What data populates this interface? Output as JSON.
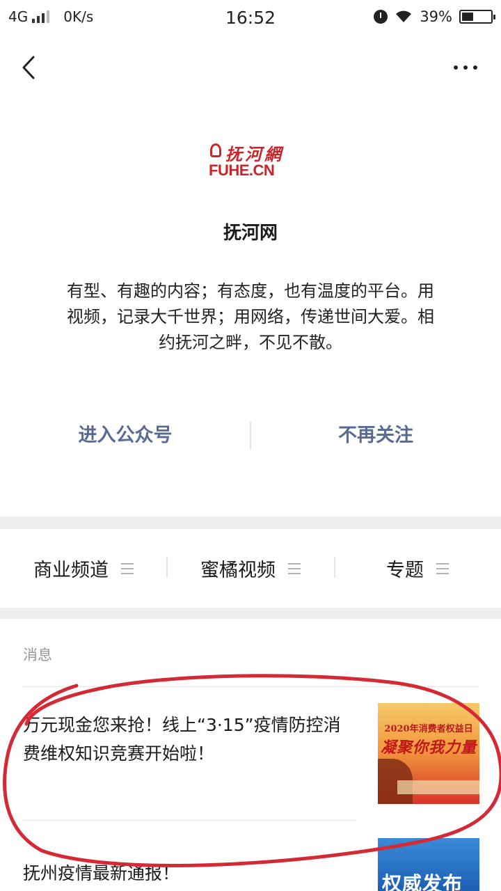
{
  "status_bar": {
    "network": "4G",
    "speed": "0K/s",
    "time": "16:52",
    "battery": "39%",
    "battery_level": 0.39
  },
  "nav": {
    "back_icon": "chevron-left-icon",
    "more_icon": "more-dots-icon"
  },
  "account": {
    "logo_text_cn": "抚河網",
    "logo_text_en": "FUHE.CN",
    "name": "抚河网",
    "description": "有型、有趣的内容；有态度，也有温度的平台。用视频，记录大千世界；用网络，传递世间大爱。相约抚河之畔，不见不散。"
  },
  "actions": {
    "enter": "进入公众号",
    "unfollow": "不再关注"
  },
  "menu": {
    "items": [
      {
        "label": "商业频道"
      },
      {
        "label": "蜜橘视频"
      },
      {
        "label": "专题"
      }
    ]
  },
  "messages": {
    "section_label": "消息",
    "items": [
      {
        "title": "万元现金您来抢！线上“3·15”疫情防控消费维权知识竞赛开始啦！",
        "thumb_year": "2020年消费者权益日",
        "thumb_slogan": "凝聚你我力量"
      },
      {
        "title": "抚州疫情最新通报！",
        "thumb_text": "权威发布"
      }
    ]
  },
  "colors": {
    "link": "#576b95",
    "logo_red": "#c8262a",
    "annotation_red": "#d42a35"
  }
}
